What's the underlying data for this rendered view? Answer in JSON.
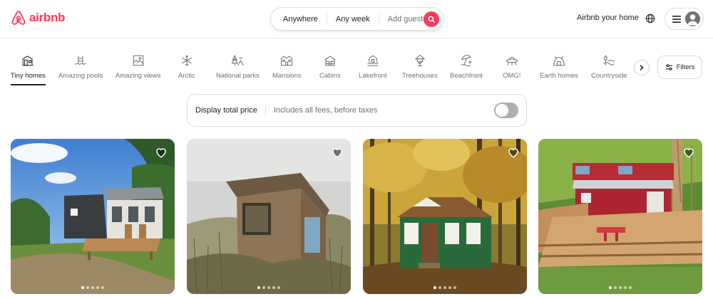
{
  "brand": {
    "name": "airbnb",
    "color": "#ff385c"
  },
  "search": {
    "where": "Anywhere",
    "when": "Any week",
    "who": "Add guests",
    "button_icon": "search-icon"
  },
  "header": {
    "host_link": "Airbnb your home",
    "globe_icon": "globe-icon",
    "menu_icon": "hamburger-icon",
    "avatar_icon": "user-icon"
  },
  "categories": [
    {
      "label": "Tiny homes",
      "icon": "tiny-home-icon",
      "active": true
    },
    {
      "label": "Amazing pools",
      "icon": "pool-icon"
    },
    {
      "label": "Amazing views",
      "icon": "view-icon"
    },
    {
      "label": "Arctic",
      "icon": "snowflake-icon"
    },
    {
      "label": "National parks",
      "icon": "national-park-icon"
    },
    {
      "label": "Mansions",
      "icon": "mansion-icon"
    },
    {
      "label": "Cabins",
      "icon": "cabin-icon"
    },
    {
      "label": "Lakefront",
      "icon": "lakefront-icon"
    },
    {
      "label": "Treehouses",
      "icon": "treehouse-icon"
    },
    {
      "label": "Beachfront",
      "icon": "beach-icon"
    },
    {
      "label": "OMG!",
      "icon": "ufo-icon"
    },
    {
      "label": "Earth homes",
      "icon": "earth-home-icon"
    },
    {
      "label": "Countryside",
      "icon": "countryside-icon"
    }
  ],
  "filters_label": "Filters",
  "total_price": {
    "title": "Display total price",
    "subtitle": "Includes all fees, before taxes",
    "enabled": false
  },
  "listings": [
    {
      "scene": "tiny home with deck on hilltop",
      "photo_count": 5,
      "current_photo": 1
    },
    {
      "scene": "rustic wooden tiny cabin in meadow",
      "photo_count": 5,
      "current_photo": 1
    },
    {
      "scene": "green cottage in autumn forest",
      "photo_count": 5,
      "current_photo": 1
    },
    {
      "scene": "red tiny barn house with deck",
      "photo_count": 5,
      "current_photo": 1
    }
  ]
}
